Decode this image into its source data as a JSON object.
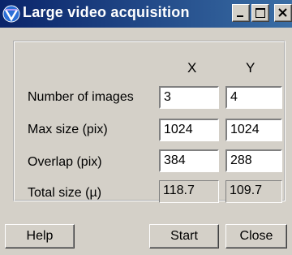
{
  "window": {
    "title": "Large video acquisition",
    "icon": "app-logo-icon"
  },
  "columns": {
    "x": "X",
    "y": "Y"
  },
  "rows": [
    {
      "label": "Number of images",
      "x": "3",
      "y": "4",
      "editable": true
    },
    {
      "label": "Max size (pix)",
      "x": "1024",
      "y": "1024",
      "editable": true
    },
    {
      "label": "Overlap (pix)",
      "x": "384",
      "y": "288",
      "editable": true
    },
    {
      "label": "Total size (µ)",
      "x": "118.7",
      "y": "109.7",
      "editable": false
    }
  ],
  "buttons": {
    "help": "Help",
    "start": "Start",
    "close": "Close"
  },
  "colors": {
    "titlebar_start": "#0a246a",
    "titlebar_end": "#3a6ea5",
    "face": "#d4d0c8"
  }
}
